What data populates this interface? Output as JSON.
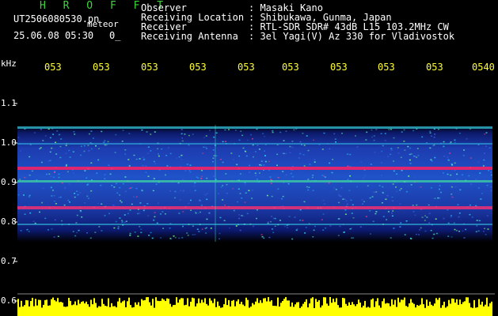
{
  "header": {
    "title": "H R O F F T",
    "file_name": "UT2506080530.pn",
    "subtitle": "meteor",
    "date_time": "25.06.08 05:30",
    "count": "0_",
    "observer_label": "Observer",
    "observer": ": Masaki Kano",
    "location_label": "Receiving Location",
    "location": ": Shibukawa, Gunma, Japan",
    "receiver_label": "Receiver",
    "receiver": ": RTL-SDR SDR# 43dB L15 103.2MHz CW",
    "antenna_label": "Receiving Antenna",
    "antenna": ": 3el Yagi(V) Az 330 for Vladivostok"
  },
  "axis": {
    "unit": "kHz",
    "time_ticks": [
      "053",
      "053",
      "053",
      "053",
      "053",
      "053",
      "053",
      "053",
      "053",
      "0540"
    ],
    "freq_ticks": [
      "1.1",
      "1.0",
      "0.9",
      "0.8",
      "0.7",
      "0.6"
    ]
  },
  "colors": {
    "background": "#000000",
    "title": "#3cd63c",
    "ticks": "#ffff33",
    "signal_low": "#1a2a9a",
    "signal_mid": "#20c8e0",
    "signal_high": "#ff2060",
    "power_bar": "#ffff00"
  }
}
